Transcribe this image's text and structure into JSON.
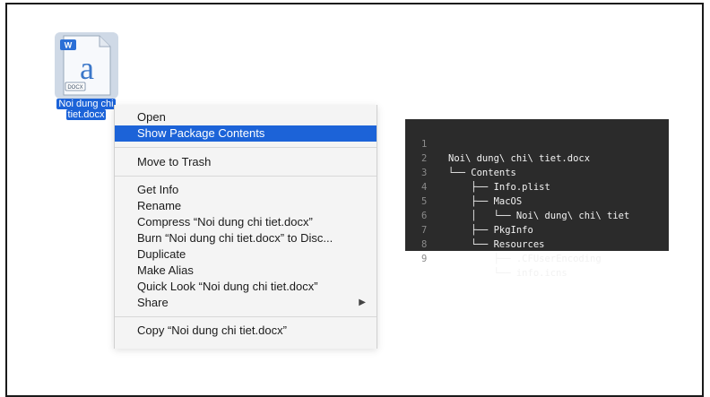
{
  "file": {
    "icon": "docx-file-icon",
    "badge": "W",
    "glyph": "a",
    "ext_label": "DOCX",
    "name_line1": "Noi dung chi",
    "name_line2": "tiet.docx"
  },
  "context_menu": {
    "highlighted_color": "#1c63d8",
    "items": [
      {
        "label": "Open"
      },
      {
        "label": "Show Package Contents"
      },
      {
        "label": "Move to Trash"
      },
      {
        "label": "Get Info"
      },
      {
        "label": "Rename"
      },
      {
        "label": "Compress “Noi dung chi tiet.docx”"
      },
      {
        "label": "Burn “Noi dung chi tiet.docx” to Disc..."
      },
      {
        "label": "Duplicate"
      },
      {
        "label": "Make Alias"
      },
      {
        "label": "Quick Look “Noi dung chi tiet.docx”"
      },
      {
        "label": "Share",
        "submenu_icon": "chevron-right-icon"
      },
      {
        "label": "Copy “Noi dung chi tiet.docx”"
      }
    ],
    "share_arrow": "▶"
  },
  "tree": {
    "lines": [
      {
        "num": "1",
        "text": "Noi\\ dung\\ chi\\ tiet.docx"
      },
      {
        "num": "2",
        "text": "└── Contents"
      },
      {
        "num": "3",
        "text": "    ├── Info.plist"
      },
      {
        "num": "4",
        "text": "    ├── MacOS"
      },
      {
        "num": "5",
        "text": "    │   └── Noi\\ dung\\ chi\\ tiet"
      },
      {
        "num": "6",
        "text": "    ├── PkgInfo"
      },
      {
        "num": "7",
        "text": "    └── Resources"
      },
      {
        "num": "8",
        "text": "        ├── .CFUserEncoding"
      },
      {
        "num": "9",
        "text": "        └── info.icns"
      }
    ]
  }
}
